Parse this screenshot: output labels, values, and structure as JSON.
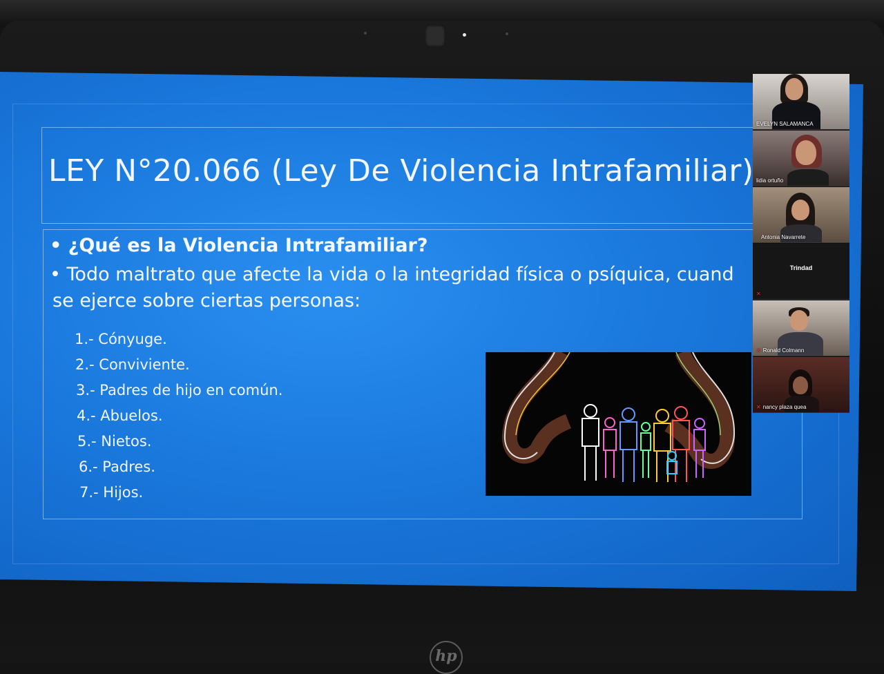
{
  "slide": {
    "title": "LEY N°20.066 (Ley De Violencia Intrafamiliar)",
    "question": "• ¿Qué es la Violencia Intrafamiliar?",
    "definition_line1": "• Todo maltrato que afecte la vida o la integridad física o psíquica, cuand",
    "definition_line2": "se ejerce sobre ciertas personas:",
    "list": [
      "1.- Cónyuge.",
      "2.- Conviviente.",
      "3.- Padres de hijo en común.",
      "4.- Abuelos.",
      "5.- Nietos.",
      "6.- Padres.",
      "7.- Hijos."
    ]
  },
  "participants": [
    {
      "name": "EVELYN SALAMANCA",
      "muted": false
    },
    {
      "name": "lidia ortuño",
      "muted": false
    },
    {
      "name": "Antonia Navarrete",
      "muted": false
    },
    {
      "name": "Trindad",
      "muted": true
    },
    {
      "name": "Ronald Colmann",
      "muted": true
    },
    {
      "name": "nancy plaza quea",
      "muted": true
    }
  ],
  "monitor": {
    "brand": "hp"
  },
  "colors": {
    "slide_blue": "#1a78dc",
    "muted_red": "#ff3030"
  }
}
